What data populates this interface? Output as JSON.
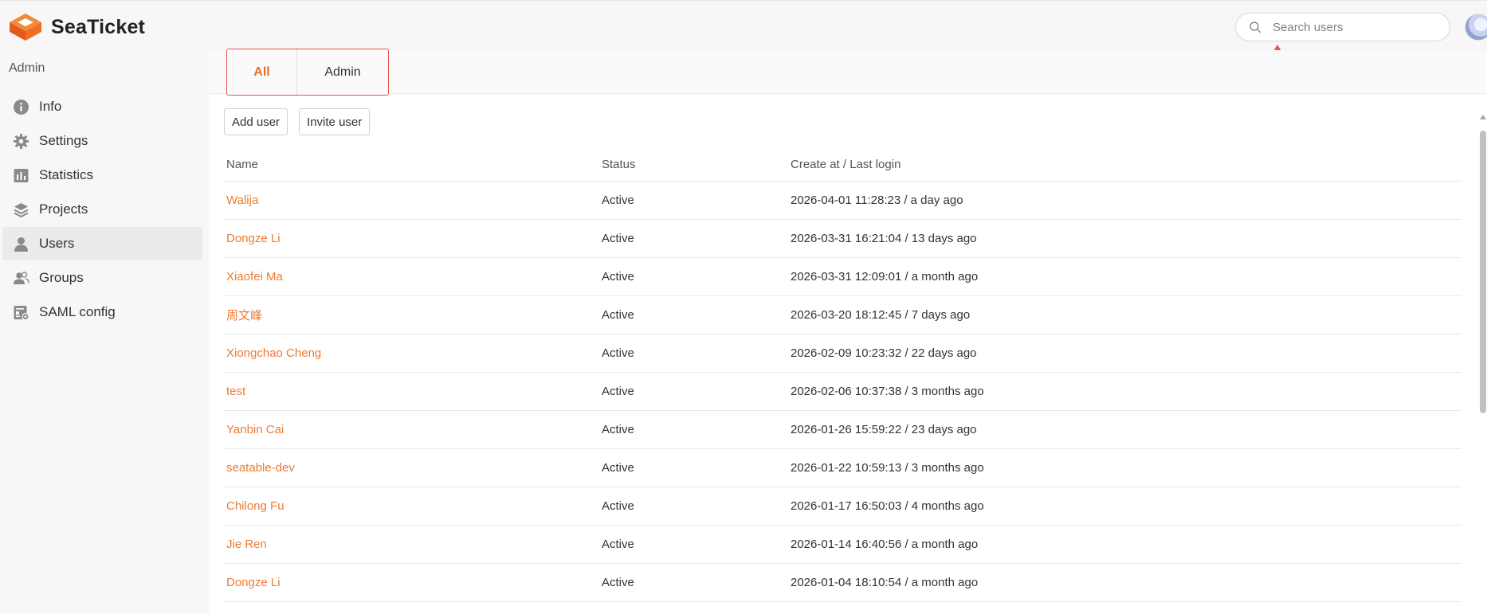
{
  "app": {
    "name": "SeaTicket",
    "brand_color": "#ed6d2c",
    "accent_color": "#ed7b33",
    "alert_color": "#e4584e"
  },
  "header": {
    "search_placeholder": "Search users",
    "search_icon": "search-icon",
    "annotation_icon": "red-arrow-up-icon",
    "avatar_icon": "user-avatar"
  },
  "sidebar": {
    "heading": "Admin",
    "items": [
      {
        "label": "Info",
        "icon": "info-icon",
        "active": false
      },
      {
        "label": "Settings",
        "icon": "gear-icon",
        "active": false
      },
      {
        "label": "Statistics",
        "icon": "bar-chart-icon",
        "active": false
      },
      {
        "label": "Projects",
        "icon": "layers-icon",
        "active": false
      },
      {
        "label": "Users",
        "icon": "user-icon",
        "active": true
      },
      {
        "label": "Groups",
        "icon": "group-icon",
        "active": false
      },
      {
        "label": "SAML config",
        "icon": "saml-icon",
        "active": false
      }
    ]
  },
  "tabs": [
    {
      "label": "All",
      "active": true
    },
    {
      "label": "Admin",
      "active": false
    }
  ],
  "toolbar": {
    "add_user_label": "Add user",
    "invite_user_label": "Invite user"
  },
  "table": {
    "columns": [
      "Name",
      "Status",
      "Create at / Last login"
    ],
    "rows": [
      {
        "name": "Walija",
        "status": "Active",
        "dates": "2026-04-01 11:28:23 / a day ago"
      },
      {
        "name": "Dongze Li",
        "status": "Active",
        "dates": "2026-03-31 16:21:04 / 13 days ago"
      },
      {
        "name": "Xiaofei Ma",
        "status": "Active",
        "dates": "2026-03-31 12:09:01 / a month ago"
      },
      {
        "name": "周文峰",
        "status": "Active",
        "dates": "2026-03-20 18:12:45 / 7 days ago"
      },
      {
        "name": "Xiongchao Cheng",
        "status": "Active",
        "dates": "2026-02-09 10:23:32 / 22 days ago"
      },
      {
        "name": "test",
        "status": "Active",
        "dates": "2026-02-06 10:37:38 / 3 months ago"
      },
      {
        "name": "Yanbin Cai",
        "status": "Active",
        "dates": "2026-01-26 15:59:22 / 23 days ago"
      },
      {
        "name": "seatable-dev",
        "status": "Active",
        "dates": "2026-01-22 10:59:13 / 3 months ago"
      },
      {
        "name": "Chilong Fu",
        "status": "Active",
        "dates": "2026-01-17 16:50:03 / 4 months ago"
      },
      {
        "name": "Jie Ren",
        "status": "Active",
        "dates": "2026-01-14 16:40:56 / a month ago"
      },
      {
        "name": "Dongze Li",
        "status": "Active",
        "dates": "2026-01-04 18:10:54 / a month ago"
      }
    ]
  }
}
